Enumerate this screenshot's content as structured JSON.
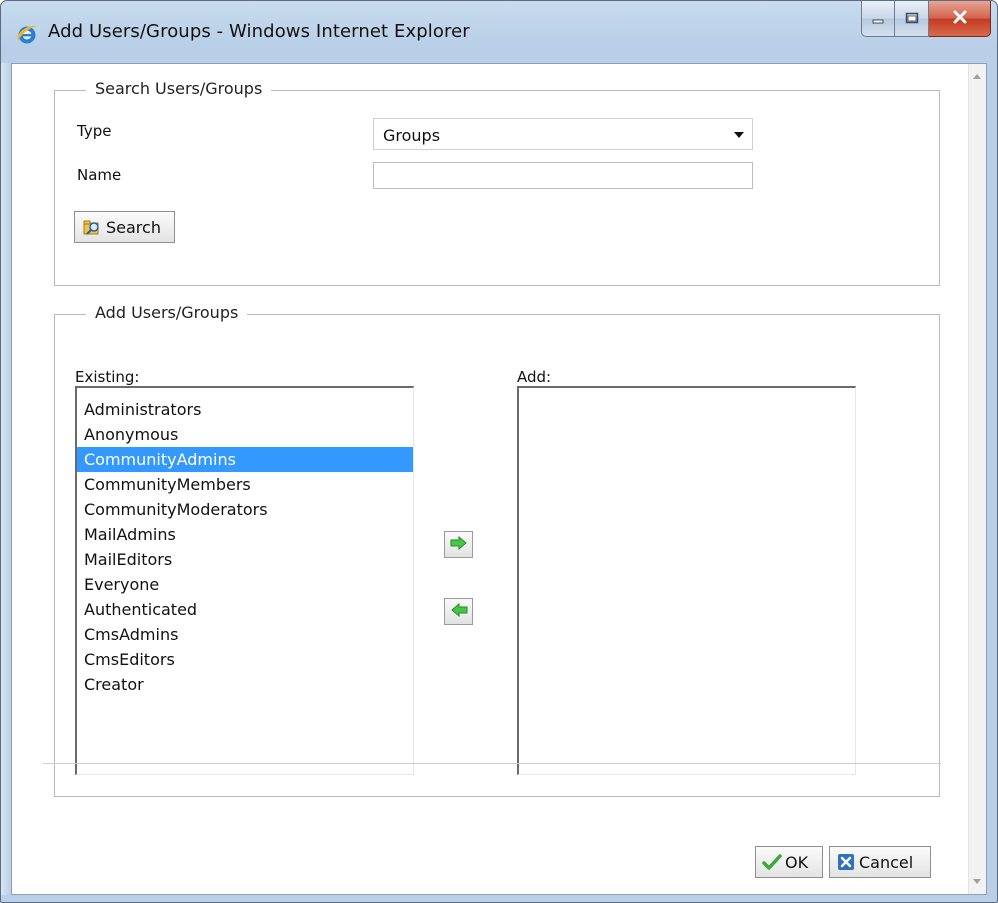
{
  "window": {
    "title": "Add Users/Groups - Windows Internet Explorer",
    "icons": [
      "ie-icon",
      "minimize-icon",
      "maximize-icon",
      "close-icon"
    ]
  },
  "search_section": {
    "legend": "Search Users/Groups",
    "type_label": "Type",
    "type_value": "Groups",
    "name_label": "Name",
    "name_value": "",
    "search_button": "Search"
  },
  "add_section": {
    "legend": "Add Users/Groups",
    "existing_label": "Existing:",
    "add_label": "Add:",
    "existing_items": [
      "Administrators",
      "Anonymous",
      "CommunityAdmins",
      "CommunityMembers",
      "CommunityModerators",
      "MailAdmins",
      "MailEditors",
      "Everyone",
      "Authenticated",
      "CmsAdmins",
      "CmsEditors",
      "Creator"
    ],
    "selected_item": "CommunityAdmins",
    "add_items": []
  },
  "footer": {
    "ok_label": "OK",
    "cancel_label": "Cancel"
  },
  "colors": {
    "selection": "#3399ff",
    "arrow_green": "#3db83d",
    "ok_check": "#3aa83a",
    "cancel_blue": "#2f6fc4"
  }
}
